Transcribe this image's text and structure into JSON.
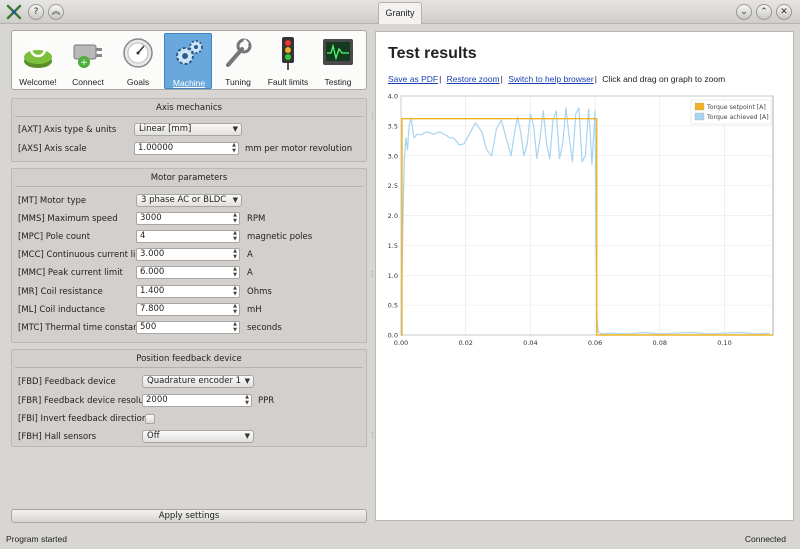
{
  "window": {
    "title": "Granity",
    "controls": [
      "help-icon",
      "minimize-icon",
      "maximize-icon",
      "close-icon"
    ]
  },
  "toolbar": {
    "items": [
      {
        "label": "Welcome!",
        "icon": "power-switch-icon"
      },
      {
        "label": "Connect",
        "icon": "plug-icon"
      },
      {
        "label": "Goals",
        "icon": "gauge-icon"
      },
      {
        "label": "Machine",
        "icon": "gears-icon",
        "active": true
      },
      {
        "label": "Tuning",
        "icon": "wrench-icon"
      },
      {
        "label": "Fault limits",
        "icon": "traffic-light-icon"
      },
      {
        "label": "Testing",
        "icon": "oscilloscope-icon"
      }
    ]
  },
  "axis_mechanics": {
    "title": "Axis mechanics",
    "type_label": "[AXT] Axis type & units",
    "type_value": "Linear [mm]",
    "scale_label": "[AXS] Axis scale",
    "scale_value": "1.00000",
    "scale_unit": "mm per motor revolution"
  },
  "motor": {
    "title": "Motor parameters",
    "type_label": "[MT] Motor type",
    "type_value": "3 phase AC or BLDC",
    "rows": [
      {
        "label": "[MMS] Maximum speed",
        "value": "3000",
        "unit": "RPM"
      },
      {
        "label": "[MPC] Pole count",
        "value": "4",
        "unit": "magnetic poles"
      },
      {
        "label": "[MCC] Continuous current limit",
        "value": "3.000",
        "unit": "A"
      },
      {
        "label": "[MMC] Peak current limit",
        "value": "6.000",
        "unit": "A"
      },
      {
        "label": "[MR] Coil resistance",
        "value": "1.400",
        "unit": "Ohms"
      },
      {
        "label": "[ML] Coil inductance",
        "value": "7.800",
        "unit": "mH"
      },
      {
        "label": "[MTC] Thermal time constant",
        "value": "500",
        "unit": "seconds"
      }
    ]
  },
  "feedback": {
    "title": "Position feedback device",
    "device_label": "[FBD] Feedback device",
    "device_value": "Quadrature encoder 1",
    "resolution_label": "[FBR] Feedback device resolution",
    "resolution_value": "2000",
    "resolution_unit": "PPR",
    "invert_label": "[FBI] Invert feedback direction",
    "invert_checked": false,
    "hall_label": "[FBH] Hall sensors",
    "hall_value": "Off"
  },
  "apply_label": "Apply settings",
  "results": {
    "title": "Test results",
    "links": [
      "Save as PDF",
      "Restore zoom",
      "Switch to help browser"
    ],
    "hint": "Click and drag on graph to zoom"
  },
  "chart_data": {
    "type": "line",
    "title": "",
    "xlabel": "",
    "ylabel": "",
    "xlim": [
      0,
      0.115
    ],
    "ylim": [
      0,
      4.0
    ],
    "x_ticks": [
      "0.00",
      "0.02",
      "0.04",
      "0.06",
      "0.08",
      "0.10"
    ],
    "y_ticks": [
      "0.0",
      "0.5",
      "1.0",
      "1.5",
      "2.0",
      "2.5",
      "3.0",
      "3.5",
      "4.0"
    ],
    "grid": true,
    "legend_position": "top-right",
    "series": [
      {
        "name": "Torque setpoint [A]",
        "color": "#f0b323",
        "x": [
          0,
          0.0003,
          0.0003,
          0.0605,
          0.0605,
          0.115
        ],
        "y": [
          0,
          0,
          3.62,
          3.62,
          0,
          0
        ]
      },
      {
        "name": "Torque achieved [A]",
        "color": "#a8d4f0",
        "x": [
          0,
          0.0005,
          0.001,
          0.0015,
          0.002,
          0.0025,
          0.003,
          0.0035,
          0.004,
          0.005,
          0.006,
          0.008,
          0.01,
          0.012,
          0.014,
          0.015,
          0.016,
          0.017,
          0.018,
          0.0195,
          0.021,
          0.023,
          0.025,
          0.0265,
          0.028,
          0.0295,
          0.031,
          0.0325,
          0.034,
          0.035,
          0.036,
          0.037,
          0.038,
          0.039,
          0.04,
          0.041,
          0.042,
          0.043,
          0.044,
          0.045,
          0.046,
          0.047,
          0.048,
          0.049,
          0.05,
          0.051,
          0.052,
          0.053,
          0.054,
          0.055,
          0.056,
          0.057,
          0.058,
          0.0585,
          0.059,
          0.0595,
          0.06,
          0.0603,
          0.0606,
          0.061,
          0.062,
          0.065,
          0.07,
          0.075,
          0.08,
          0.085,
          0.09,
          0.095,
          0.1,
          0.105,
          0.11,
          0.114
        ],
        "y": [
          0,
          1.6,
          2.9,
          3.3,
          3.1,
          3.5,
          3.62,
          3.5,
          3.3,
          3.36,
          3.35,
          3.4,
          3.36,
          3.4,
          3.34,
          3.3,
          3.3,
          3.25,
          3.18,
          3.2,
          3.35,
          3.55,
          3.4,
          3.1,
          3.0,
          3.45,
          3.6,
          3.3,
          3.0,
          3.35,
          3.65,
          3.4,
          3.0,
          3.2,
          3.7,
          3.5,
          2.95,
          3.3,
          3.75,
          3.2,
          2.95,
          3.6,
          3.75,
          2.95,
          3.2,
          3.8,
          3.3,
          2.9,
          3.7,
          3.8,
          2.9,
          3.0,
          3.78,
          3.4,
          2.85,
          3.3,
          3.75,
          1.5,
          0.3,
          0.05,
          0.02,
          0.03,
          0.02,
          0.04,
          0.02,
          0.03,
          0.04,
          0.02,
          0.03,
          0.04,
          0.02,
          0.03
        ]
      }
    ]
  },
  "status": {
    "left": "Program started",
    "right": "Connected"
  }
}
